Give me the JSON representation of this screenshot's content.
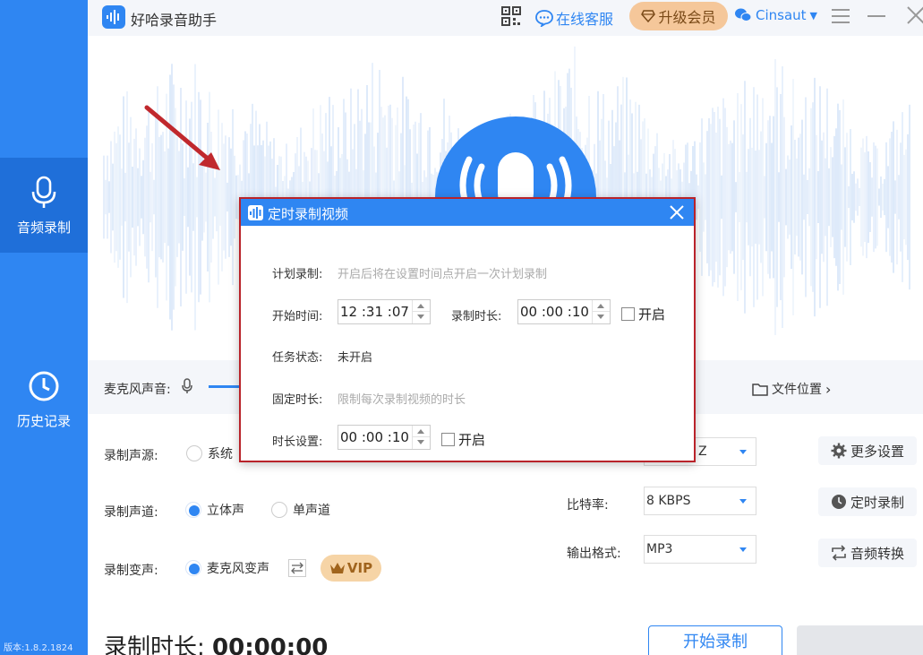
{
  "app": {
    "title": "好哈录音助手",
    "service_label": "在线客服",
    "upgrade_label": "升级会员",
    "user_name": "Cinsaut",
    "version": "版本:1.8.2.1824"
  },
  "sidebar": {
    "items": [
      {
        "label": "音频录制",
        "icon": "microphone-icon",
        "active": true
      },
      {
        "label": "历史记录",
        "icon": "clock-icon",
        "active": false
      }
    ]
  },
  "recorder": {
    "mic_volume_label": "麦克风声音:",
    "file_location_label": "文件位置",
    "source_label": "录制声源:",
    "source_option_1": "系统",
    "channel_label": "录制声道:",
    "channel_options": [
      "立体声",
      "单声道"
    ],
    "voice_change_label": "录制变声:",
    "voice_change_option": "麦克风变声",
    "vip_label": "VIP",
    "samplerate_value": "Z",
    "bitrate_label": "比特率:",
    "bitrate_value": "8 KBPS",
    "format_label": "输出格式:",
    "format_value": "MP3",
    "more_settings_label": "更多设置",
    "scheduled_label": "定时录制",
    "convert_label": "音频转换",
    "duration_label": "录制时长:",
    "duration_value": "00:00:00",
    "start_button": "开始录制"
  },
  "dialog": {
    "title": "定时录制视频",
    "plan_label": "计划录制:",
    "plan_hint": "开启后将在设置时间点开启一次计划录制",
    "start_time_label": "开始时间:",
    "start_time_value": "12 :31 :07",
    "record_duration_label": "录制时长:",
    "record_duration_value": "00 :00 :10",
    "enable_label_1": "开启",
    "task_status_label": "任务状态:",
    "task_status_value": "未开启",
    "fixed_duration_label": "固定时长:",
    "fixed_duration_hint": "限制每次录制视频的时长",
    "duration_setting_label": "时长设置:",
    "duration_setting_value": "00 :00 :10",
    "enable_label_2": "开启"
  },
  "colors": {
    "brand_blue": "#2f86f2",
    "dialog_border": "#b9232a",
    "upgrade_bg": "#f5c79a"
  }
}
